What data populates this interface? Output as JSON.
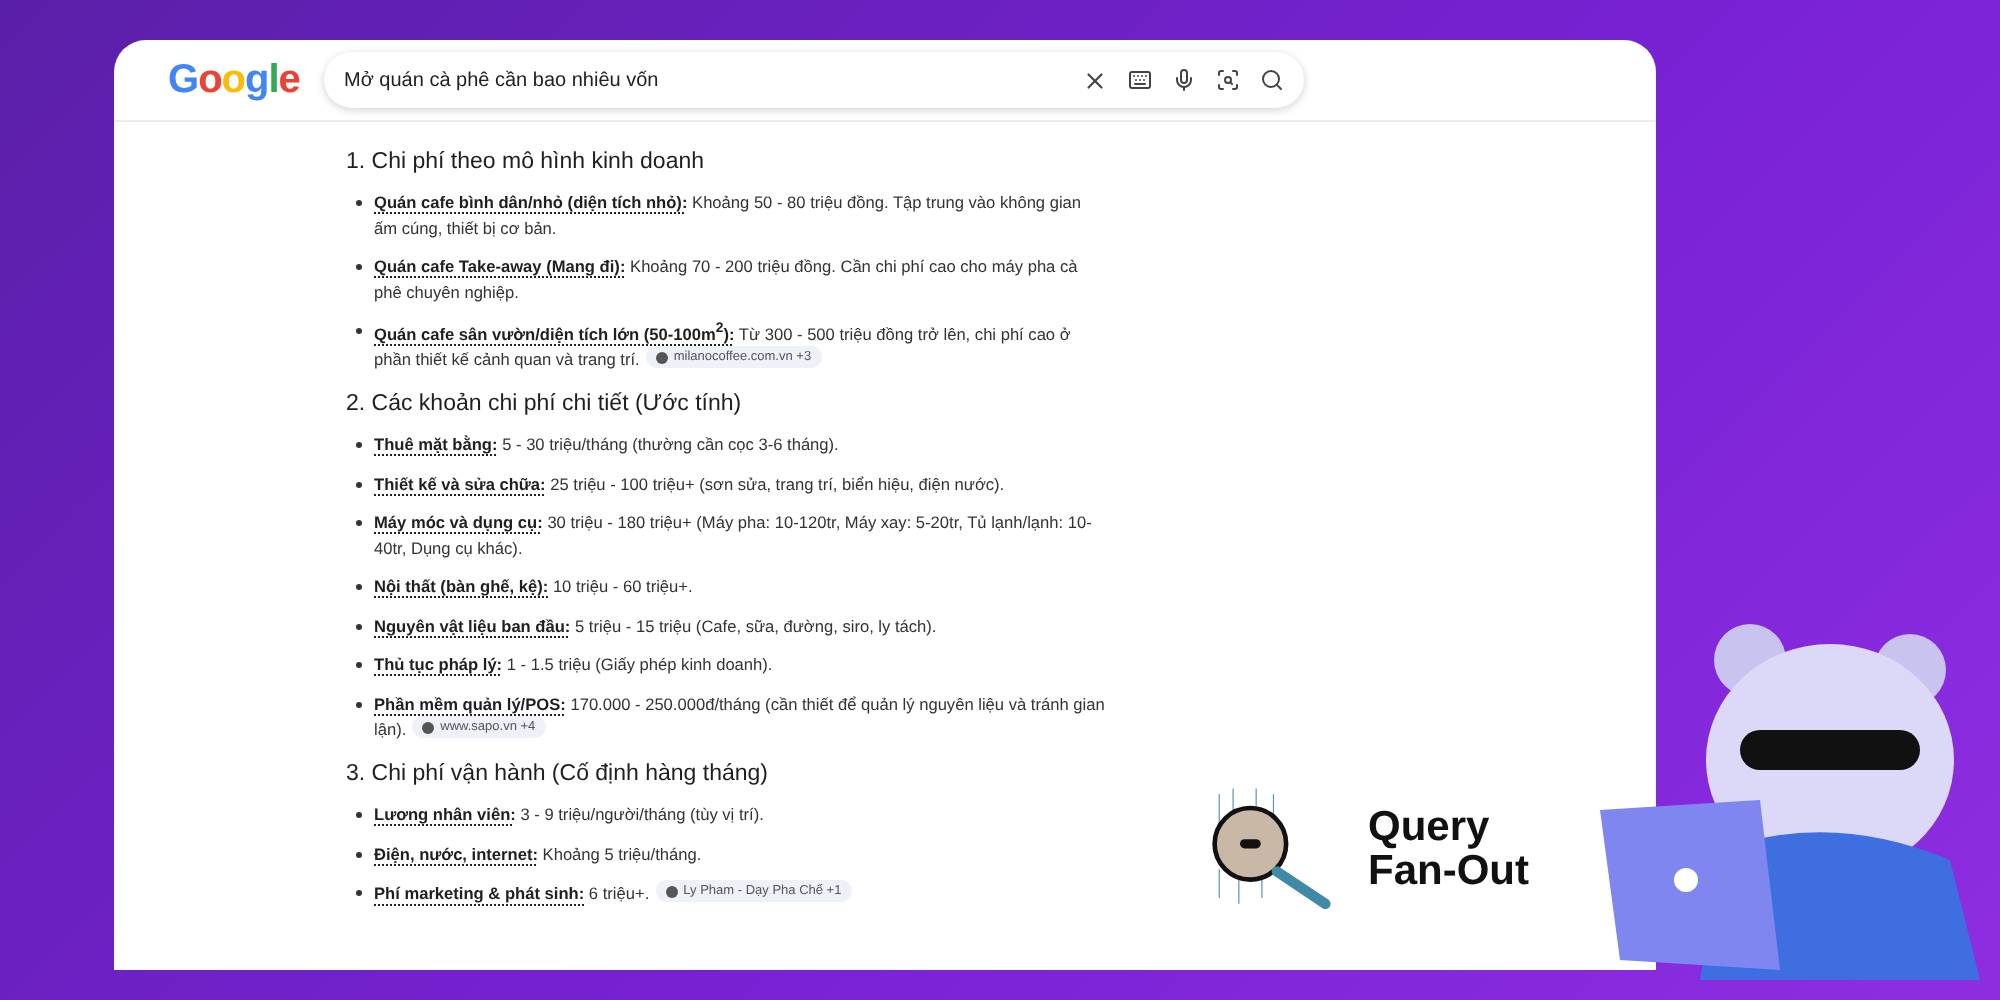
{
  "header": {
    "logo": "Google",
    "search_value": "Mở quán cà phê cần bao nhiêu vốn"
  },
  "sections": [
    {
      "title": "1. Chi phí theo mô hình kinh doanh",
      "items": [
        {
          "label": "Quán cafe bình dân/nhỏ (diện tích nhỏ):",
          "text": "Khoảng 50 - 80 triệu đồng. Tập trung vào không gian ấm cúng, thiết bị cơ bản."
        },
        {
          "label": "Quán cafe Take-away (Mang đi):",
          "text": "Khoảng 70 - 200 triệu đồng. Cần chi phí cao cho máy pha cà phê chuyên nghiệp."
        },
        {
          "label": "Quán cafe sân vườn/diện tích lớn (50-100m$^{2}$):",
          "text": "Từ 300 - 500 triệu đồng trở lên, chi phí cao ở phần thiết kế cảnh quan và trang trí.",
          "source": "milanocoffee.com.vn +3"
        }
      ]
    },
    {
      "title": "2. Các khoản chi phí chi tiết (Ước tính)",
      "items": [
        {
          "label": "Thuê mặt bằng:",
          "text": "5 - 30 triệu/tháng (thường cần cọc 3-6 tháng)."
        },
        {
          "label": "Thiết kế và sửa chữa:",
          "text": "25 triệu - 100 triệu+ (sơn sửa, trang trí, biển hiệu, điện nước)."
        },
        {
          "label": "Máy móc và dụng cụ:",
          "text": "30 triệu - 180 triệu+ (Máy pha: 10-120tr, Máy xay: 5-20tr, Tủ lạnh/lạnh: 10-40tr, Dụng cụ khác)."
        },
        {
          "label": "Nội thất (bàn ghế, kệ):",
          "text": "10 triệu - 60 triệu+."
        },
        {
          "label": "Nguyên vật liệu ban đầu:",
          "text": "5 triệu - 15 triệu (Cafe, sữa, đường, siro, ly tách)."
        },
        {
          "label": "Thủ tục pháp lý:",
          "text": "1 - 1.5 triệu (Giấy phép kinh doanh)."
        },
        {
          "label": "Phần mềm quản lý/POS:",
          "text": "170.000 - 250.000đ/tháng (cần thiết để quản lý nguyên liệu và tránh gian lận).",
          "source": "www.sapo.vn +4"
        }
      ]
    },
    {
      "title": "3. Chi phí vận hành (Cố định hàng tháng)",
      "items": [
        {
          "label": "Lương nhân viên:",
          "text": "3 - 9 triệu/người/tháng (tùy vị trí)."
        },
        {
          "label": "Điện, nước, internet:",
          "text": "Khoảng 5 triệu/tháng."
        },
        {
          "label": "Phí marketing & phát sinh:",
          "text": "6 triệu+.",
          "source": "Ly Pham - Dạy Pha Chế +1"
        }
      ]
    }
  ],
  "badge": {
    "line_1": "Query",
    "line_2": "Fan-Out"
  }
}
